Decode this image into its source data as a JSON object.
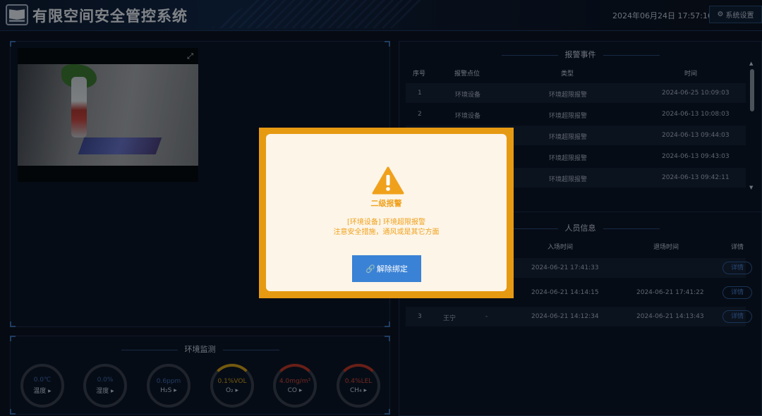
{
  "header": {
    "title": "有限空间安全管控系统",
    "datetime": "2024年06月24日 17:57:16",
    "settings_label": "系统设置",
    "settings_icon": "gear-icon"
  },
  "env": {
    "title": "环境监测",
    "gauges": [
      {
        "value": "0.0℃",
        "label": "温度 ▸"
      },
      {
        "value": "0.0%",
        "label": "湿度 ▸"
      },
      {
        "value": "0.6ppm",
        "label": "H₂S ▸"
      },
      {
        "value": "0.1%VOL",
        "label": "O₂ ▸"
      },
      {
        "value": "4.0mg/m³",
        "label": "CO ▸"
      },
      {
        "value": "0.4%LEL",
        "label": "CH₄ ▸"
      }
    ]
  },
  "alarms": {
    "title": "报警事件",
    "headers": {
      "no": "序号",
      "point": "报警点位",
      "type": "类型",
      "time": "时间"
    },
    "rows": [
      {
        "no": "1",
        "point": "环境设备",
        "type": "环境超限报警",
        "time": "2024-06-25 10:09:03"
      },
      {
        "no": "2",
        "point": "环境设备",
        "type": "环境超限报警",
        "time": "2024-06-13 10:08:03"
      },
      {
        "no": "",
        "point": "",
        "type": "环境超限报警",
        "time": "2024-06-13 09:44:03"
      },
      {
        "no": "",
        "point": "",
        "type": "环境超限报警",
        "time": "2024-06-13 09:43:03"
      },
      {
        "no": "",
        "point": "",
        "type": "环境超限报警",
        "time": "2024-06-13 09:42:11"
      }
    ]
  },
  "personnel": {
    "title": "人员信息",
    "headers": {
      "enter": "入场时间",
      "exit": "退场时间",
      "detail": "详情"
    },
    "rows": [
      {
        "no": "",
        "name": "",
        "dash": "",
        "enter": "2024-06-21 17:41:33",
        "exit": "",
        "detail": "详情"
      },
      {
        "no": "",
        "name": "",
        "dash": "",
        "enter": "2024-06-21 14:14:15",
        "exit": "2024-06-21 17:41:22",
        "detail": "详情"
      },
      {
        "no": "3",
        "name": "王宁",
        "dash": "-",
        "enter": "2024-06-21 14:12:34",
        "exit": "2024-06-21 14:13:43",
        "detail": "详情"
      }
    ]
  },
  "modal": {
    "level": "二级报警",
    "message_line1": "[环境设备] 环境超限报警",
    "message_line2": "注意安全措施，通风或是其它方面",
    "button_label": "解除绑定",
    "button_icon": "link-icon",
    "warning_icon": "warning-triangle-icon",
    "accent": "#e69a12"
  }
}
